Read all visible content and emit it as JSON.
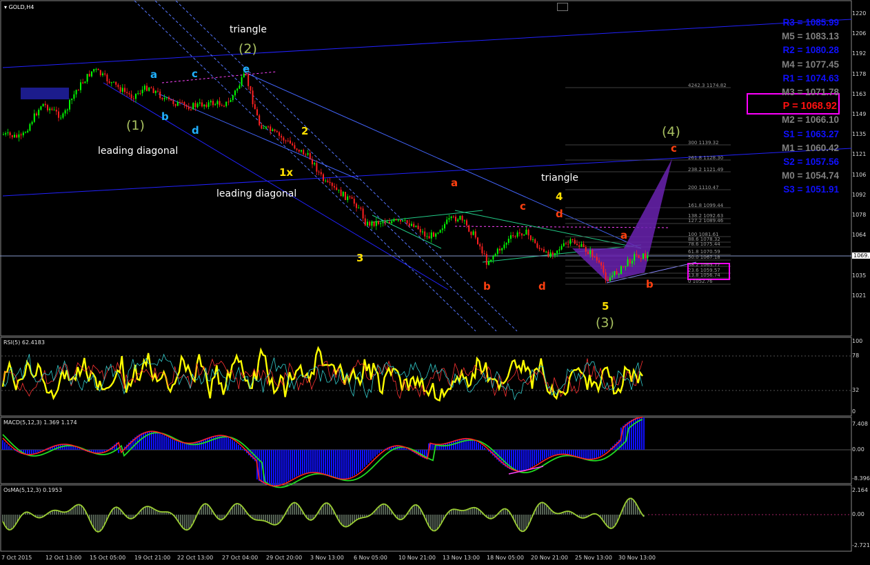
{
  "symbol": {
    "title": "GOLD,H4"
  },
  "indicators": {
    "rsi_title": "RSI(5) 62.4183",
    "macd_title": "MACD(5,12,3) 1.369 1.174",
    "osma_title": "OsMA(5,12,3) 0.1953"
  },
  "pivots": [
    {
      "label": "R3 = 1085.99",
      "color": "#1010ff"
    },
    {
      "label": "M5 = 1083.13",
      "color": "#808080"
    },
    {
      "label": "R2 = 1080.28",
      "color": "#1010ff"
    },
    {
      "label": "M4 = 1077.45",
      "color": "#808080"
    },
    {
      "label": "R1 = 1074.63",
      "color": "#1010ff"
    },
    {
      "label": "M3 = 1071.78",
      "color": "#808080"
    },
    {
      "label": "P  = 1068.92",
      "color": "#ff1010"
    },
    {
      "label": "M2 = 1066.10",
      "color": "#808080"
    },
    {
      "label": "S1 = 1063.27",
      "color": "#1010ff"
    },
    {
      "label": "M1 = 1060.42",
      "color": "#808080"
    },
    {
      "label": "S2 = 1057.56",
      "color": "#1010ff"
    },
    {
      "label": "M0 = 1054.74",
      "color": "#808080"
    },
    {
      "label": "S3 = 1051.91",
      "color": "#1010ff"
    }
  ],
  "price_axis": [
    "1220",
    "1206",
    "1192",
    "1178",
    "1163",
    "1149",
    "1135",
    "1121",
    "1106",
    "1092",
    "1078",
    "1064",
    "1050",
    "1035",
    "1021"
  ],
  "current_price": "1069.",
  "rsi_axis": [
    "100",
    "78",
    "32",
    "0"
  ],
  "macd_axis": [
    "7.408",
    "0.00",
    "-8.396"
  ],
  "osma_axis": [
    "2.164",
    "0.00",
    "-2.721"
  ],
  "time_axis": [
    "7 Oct 2015",
    "12 Oct 13:00",
    "15 Oct 05:00",
    "19 Oct 21:00",
    "22 Oct 13:00",
    "27 Oct 04:00",
    "29 Oct 20:00",
    "3 Nov 13:00",
    "6 Nov 05:00",
    "10 Nov 21:00",
    "13 Nov 13:00",
    "18 Nov 05:00",
    "20 Nov 21:00",
    "25 Nov 13:00",
    "30 Nov 13:00"
  ],
  "fib_levels": [
    "4242.3 1174.82",
    "300 1139.32",
    "261.8 1128.30",
    "238.2 1121.49",
    "200 1110.47",
    "161.8 1099.44",
    "138.2 1092.63",
    "127.2 1089.46",
    "100 1081.61",
    "88.6 1078.32",
    "78.6 1075.44",
    "61.8 1070.59",
    "50.0 1067.18",
    "38.2 1063.77",
    "23.6 1059.57",
    "13.8 1056.74",
    "0 1052.76"
  ],
  "annotations": {
    "triangle_top": "triangle",
    "wave2": "(2)",
    "wave1": "(1)",
    "leading_diag_1": "leading diagonal",
    "leading_diag_2": "leading diagonal",
    "triangle_right": "triangle",
    "wave4": "(4)",
    "wave3": "(3)",
    "w_1x": "1x",
    "w_2": "2",
    "w_3": "3",
    "w_4": "4",
    "w_5": "5",
    "a_red_1": "a",
    "c_red_1": "c",
    "d_red_1": "d",
    "b_red_1": "b",
    "d_red_2": "d",
    "a_red_2": "a",
    "b_red_2": "b",
    "c_red_2": "c",
    "a_cyan_1": "a",
    "b_cyan_1": "b",
    "c_cyan_1": "c",
    "d_cyan_1": "d",
    "e_cyan_1": "e"
  },
  "colors": {
    "background": "#000000",
    "bull_candle": "#00ff00",
    "bear_candle": "#ff0000",
    "rsi": "#ffff00",
    "macd_hist": "#0000ff",
    "osma": "#9acd32",
    "pivot_box": "#ff00ff"
  }
}
